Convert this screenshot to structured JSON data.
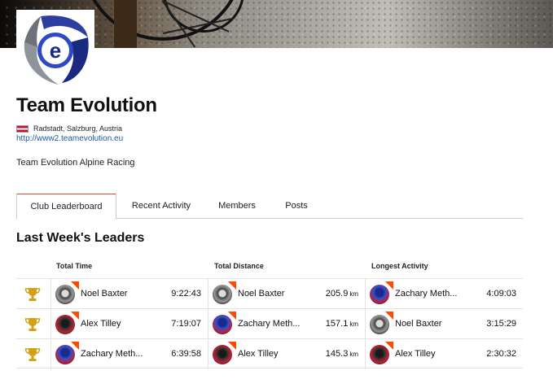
{
  "club": {
    "name": "Team Evolution",
    "location": "Radstadt, Salzburg, Austria",
    "website": "http://www2.teamevolution.eu",
    "description": "Team Evolution Alpine Racing",
    "flag_colors": [
      "#c8102e",
      "#ffffff"
    ],
    "logo_icon": "team-evolution-e-logo"
  },
  "tabs": [
    {
      "label": "Club Leaderboard",
      "active": true
    },
    {
      "label": "Recent Activity",
      "active": false
    },
    {
      "label": "Members",
      "active": false
    },
    {
      "label": "Posts",
      "active": false
    }
  ],
  "leaderboard": {
    "title": "Last Week's Leaders",
    "columns": [
      "Total Time",
      "Total Distance",
      "Longest Activity"
    ],
    "rows": [
      {
        "trophy_icon": "trophy-icon",
        "time": {
          "name": "Noel Baxter",
          "value": "9:22:43",
          "avatar": "grey"
        },
        "distance": {
          "name": "Noel Baxter",
          "value": "205.9",
          "unit": "km",
          "avatar": "grey"
        },
        "longest": {
          "name": "Zachary Meth...",
          "value": "4:09:03",
          "avatar": "blue"
        }
      },
      {
        "trophy_icon": "trophy-icon",
        "time": {
          "name": "Alex Tilley",
          "value": "7:19:07",
          "avatar": "red"
        },
        "distance": {
          "name": "Zachary Meth...",
          "value": "157.1",
          "unit": "km",
          "avatar": "blue"
        },
        "longest": {
          "name": "Noel Baxter",
          "value": "3:15:29",
          "avatar": "grey"
        }
      },
      {
        "trophy_icon": "trophy-icon",
        "time": {
          "name": "Zachary Meth...",
          "value": "6:39:58",
          "avatar": "blue"
        },
        "distance": {
          "name": "Alex Tilley",
          "value": "145.3",
          "unit": "km",
          "avatar": "red"
        },
        "longest": {
          "name": "Alex Tilley",
          "value": "2:30:32",
          "avatar": "red"
        }
      }
    ]
  },
  "colors": {
    "accent": "#fc4c02",
    "link": "#1f5aa0",
    "trophy": "#d4a017",
    "tab_top_border": "#c65a3a"
  }
}
